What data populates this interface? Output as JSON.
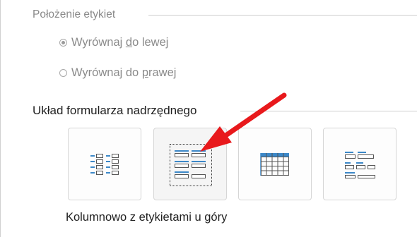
{
  "label_position": {
    "title": "Położenie etykiet",
    "options": [
      {
        "pre": "Wyrównaj ",
        "key": "d",
        "post": "o lewej",
        "checked": true
      },
      {
        "pre": "Wyrównaj do ",
        "key": "p",
        "post": "rawej",
        "checked": false
      }
    ]
  },
  "parent_layout": {
    "title": "Układ formularza nadrzędnego",
    "buttons": [
      {
        "name": "columnar-layout",
        "icon": "columnar-layout-icon",
        "selected": false
      },
      {
        "name": "columnar-labels-above-layout",
        "icon": "labels-above-layout-icon",
        "selected": true
      },
      {
        "name": "tabular-layout",
        "icon": "tabular-grid-icon",
        "selected": false
      },
      {
        "name": "justified-layout",
        "icon": "justified-layout-icon",
        "selected": false
      }
    ],
    "caption": "Kolumnowo z etykietami u góry"
  },
  "colors": {
    "accent_blue": "#3c88c8",
    "arrow_red": "#e8191c"
  }
}
